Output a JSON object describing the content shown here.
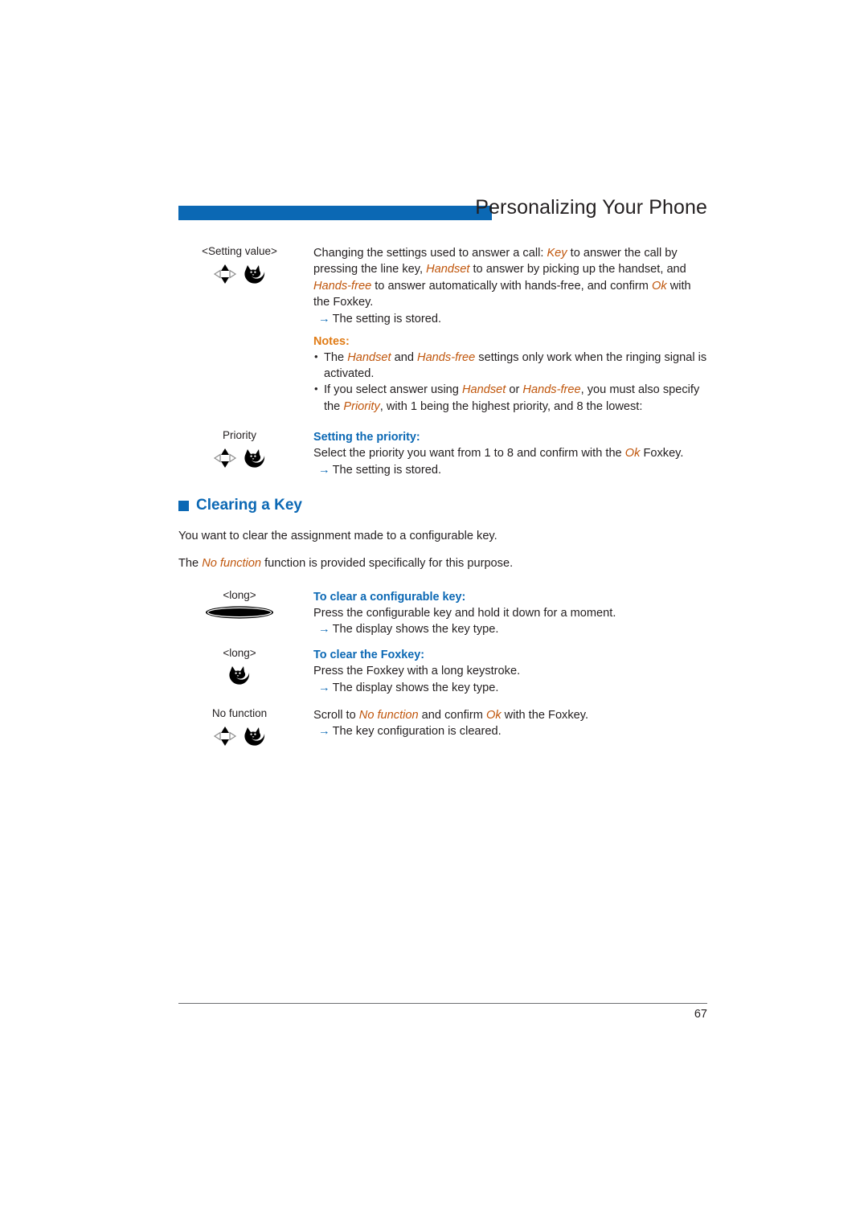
{
  "header": {
    "title": "Personalizing Your Phone",
    "bar_color": "#0b68b4"
  },
  "colors": {
    "accent_blue": "#0b68b4",
    "term_orange": "#c0560c",
    "notes_orange": "#e07b15",
    "body_text": "#231f20"
  },
  "sections": {
    "setting_value": {
      "margin_label": "<Setting value>",
      "icons": [
        "navigation-key-icon",
        "foxkey-icon"
      ],
      "para_1": "Changing the settings used to answer a call: ",
      "term_key": "Key",
      "para_2": " to answer the call by pressing the line key, ",
      "term_handset": "Handset",
      "para_3": " to answer by picking up the handset, and ",
      "term_handsfree": "Hands-free",
      "para_4": " to answer automatically with hands-free, and confirm ",
      "term_ok": "Ok",
      "para_5": " with the Foxkey.",
      "result": "The setting is stored.",
      "arrow": "→"
    },
    "notes": {
      "heading": "Notes:",
      "items": [
        {
          "pre": "The ",
          "t1": "Handset",
          "mid": " and ",
          "t2": "Hands-free",
          "post": " settings only work when the ringing signal is activated."
        },
        {
          "pre": "If you select answer using ",
          "t1": "Handset",
          "mid": " or ",
          "t2": "Hands-free",
          "post": ", you must also specify the ",
          "t3": "Priority",
          "tail": ", with 1 being the highest priority, and 8 the lowest:"
        }
      ]
    },
    "priority": {
      "margin_label": "Priority",
      "icons": [
        "navigation-key-icon",
        "foxkey-icon"
      ],
      "subhead": "Setting the priority:",
      "para_1": "Select the priority you want from 1 to 8 and confirm with the  ",
      "term_ok": "Ok",
      "para_2": " Foxkey.",
      "result": "The setting is stored.",
      "arrow": "→"
    },
    "clearing_a_key": {
      "heading": "Clearing a Key",
      "intro": "You want to clear the assignment made to a configurable key.",
      "purpose_pre": "The ",
      "purpose_term": "No function",
      "purpose_post": " function is provided specifically for this purpose."
    },
    "clear_configurable_key": {
      "margin_label": "<long>",
      "icons": [
        "configurable-key-icon"
      ],
      "subhead": "To clear a configurable key:",
      "para": "Press the configurable key and hold it down for a moment.",
      "result": "The display shows the key type.",
      "arrow": "→"
    },
    "clear_foxkey": {
      "margin_label": "<long>",
      "icons": [
        "foxkey-icon"
      ],
      "subhead": "To clear the Foxkey:",
      "para": "Press the Foxkey with a long keystroke.",
      "result": "The display shows the key type.",
      "arrow": "→"
    },
    "no_function": {
      "margin_label": "No function",
      "icons": [
        "navigation-key-icon",
        "foxkey-icon"
      ],
      "para_1": "Scroll to ",
      "term_nofunction": "No function",
      "para_2": " and confirm ",
      "term_ok": "Ok",
      "para_3": " with the Foxkey.",
      "result": "The key configuration is cleared.",
      "arrow": "→"
    }
  },
  "footer": {
    "page_number": "67"
  }
}
